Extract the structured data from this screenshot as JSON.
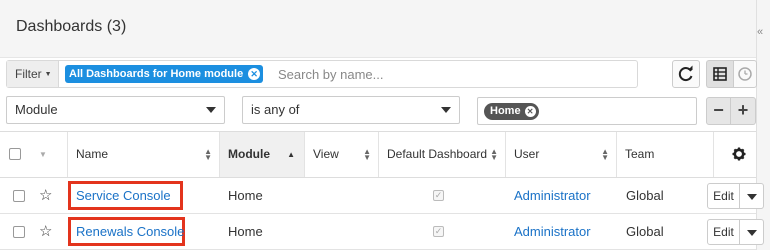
{
  "header": {
    "title": "Dashboards (3)"
  },
  "filter": {
    "dropdown_label": "Filter",
    "active_filter": "All Dashboards for Home module",
    "search_placeholder": "Search by name..."
  },
  "filter_row": {
    "field": "Module",
    "operator": "is any of",
    "value_tag": "Home"
  },
  "table": {
    "columns": [
      "Name",
      "Module",
      "View",
      "Default Dashboard",
      "User",
      "Team"
    ],
    "sorted_column": "Module",
    "rows": [
      {
        "name": "Service Console",
        "module": "Home",
        "view": "",
        "default_dashboard": true,
        "user": "Administrator",
        "team": "Global",
        "action": "Edit"
      },
      {
        "name": "Renewals Console",
        "module": "Home",
        "view": "",
        "default_dashboard": true,
        "user": "Administrator",
        "team": "Global",
        "action": "Edit"
      }
    ]
  },
  "icons": {
    "refresh": "refresh-icon",
    "list_view": "list-view-icon",
    "activity_view": "clock-icon",
    "settings": "gear-icon",
    "favorite": "star-icon"
  },
  "colors": {
    "accent": "#1c8fe0",
    "link": "#1a72c7",
    "highlight": "#e3341d"
  }
}
